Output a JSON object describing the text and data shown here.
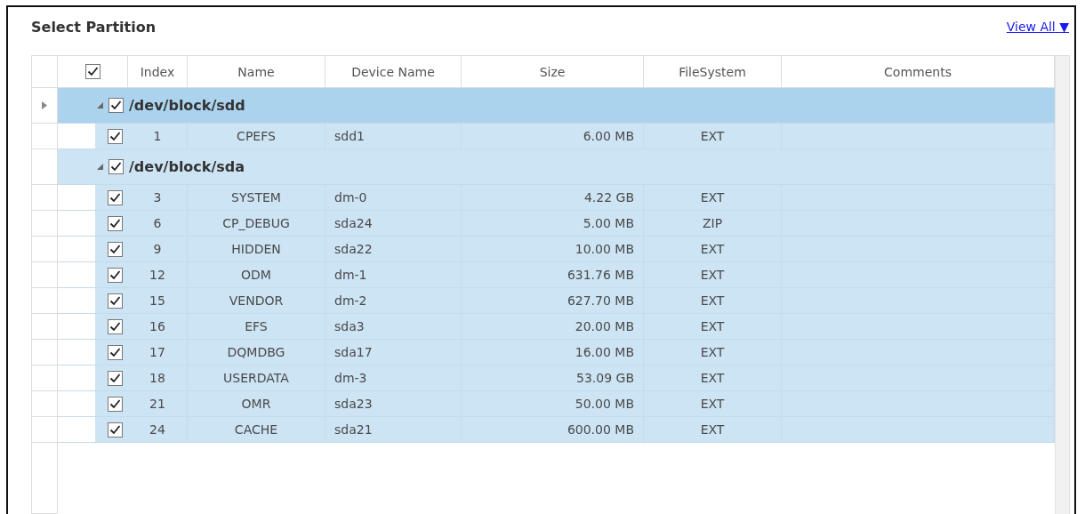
{
  "title": "Select Partition",
  "view_all": {
    "label": "View All",
    "caret": "▼"
  },
  "header": {
    "checked": true
  },
  "columns": [
    "Index",
    "Name",
    "Device Name",
    "Size",
    "FileSystem",
    "Comments"
  ],
  "groups": [
    {
      "label": "/dev/block/sdd",
      "current": true,
      "expanded": true,
      "checked": true,
      "selected": true,
      "rows": [
        {
          "checked": true,
          "cells": [
            "1",
            "CPEFS",
            "sdd1",
            "6.00 MB",
            "EXT",
            ""
          ]
        }
      ]
    },
    {
      "label": "/dev/block/sda",
      "current": false,
      "expanded": true,
      "checked": true,
      "selected": false,
      "rows": [
        {
          "checked": true,
          "cells": [
            "3",
            "SYSTEM",
            "dm-0",
            "4.22 GB",
            "EXT",
            ""
          ]
        },
        {
          "checked": true,
          "cells": [
            "6",
            "CP_DEBUG",
            "sda24",
            "5.00 MB",
            "ZIP",
            ""
          ]
        },
        {
          "checked": true,
          "cells": [
            "9",
            "HIDDEN",
            "sda22",
            "10.00 MB",
            "EXT",
            ""
          ]
        },
        {
          "checked": true,
          "cells": [
            "12",
            "ODM",
            "dm-1",
            "631.76 MB",
            "EXT",
            ""
          ]
        },
        {
          "checked": true,
          "cells": [
            "15",
            "VENDOR",
            "dm-2",
            "627.70 MB",
            "EXT",
            ""
          ]
        },
        {
          "checked": true,
          "cells": [
            "16",
            "EFS",
            "sda3",
            "20.00 MB",
            "EXT",
            ""
          ]
        },
        {
          "checked": true,
          "cells": [
            "17",
            "DQMDBG",
            "sda17",
            "16.00 MB",
            "EXT",
            ""
          ]
        },
        {
          "checked": true,
          "cells": [
            "18",
            "USERDATA",
            "dm-3",
            "53.09 GB",
            "EXT",
            ""
          ]
        },
        {
          "checked": true,
          "cells": [
            "21",
            "OMR",
            "sda23",
            "50.00 MB",
            "EXT",
            ""
          ]
        },
        {
          "checked": true,
          "cells": [
            "24",
            "CACHE",
            "sda21",
            "600.00 MB",
            "EXT",
            ""
          ]
        }
      ]
    }
  ]
}
